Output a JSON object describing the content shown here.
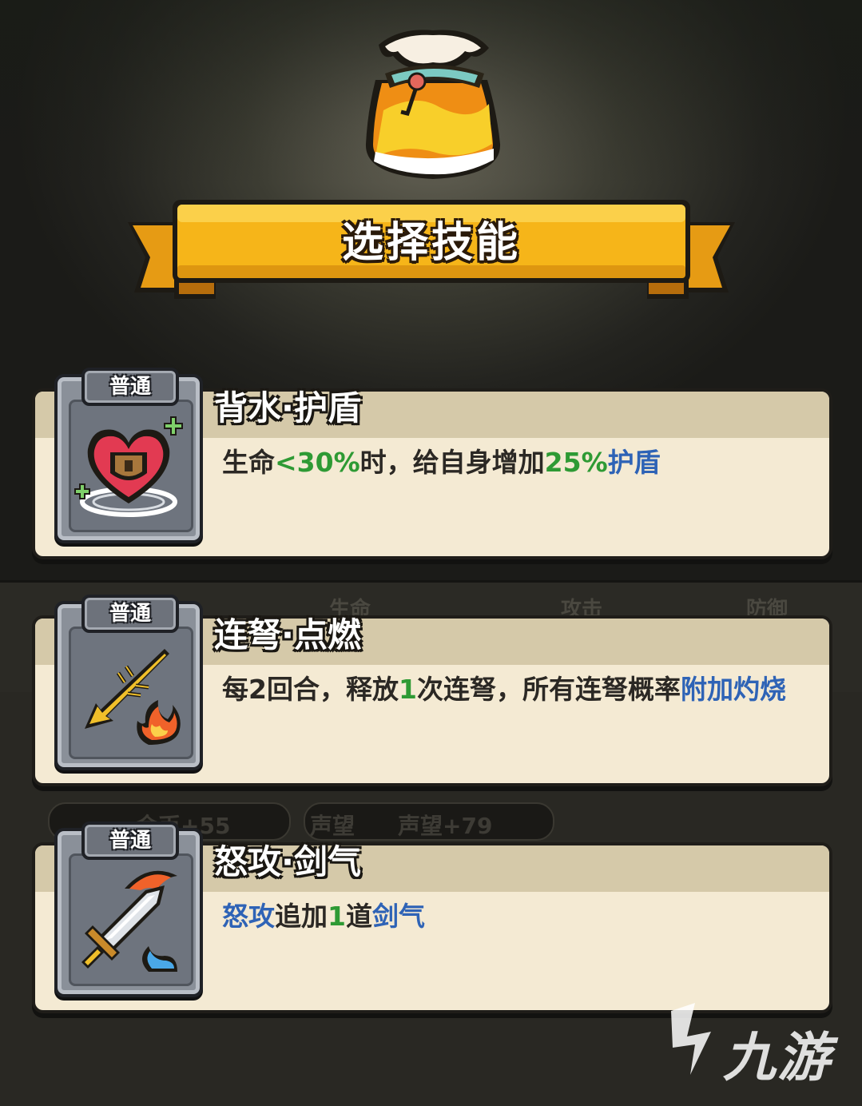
{
  "header": {
    "title": "选择技能"
  },
  "background": {
    "stats": [
      "生命",
      "攻击",
      "防御"
    ],
    "rewards": [
      "金币+55",
      "声望",
      "声望+79"
    ]
  },
  "skills": [
    {
      "tier": "普通",
      "name": "背水·护盾",
      "desc": [
        {
          "t": "生命",
          "c": "normal"
        },
        {
          "t": "<30%",
          "c": "green"
        },
        {
          "t": "时，给自身增加",
          "c": "normal"
        },
        {
          "t": "25%",
          "c": "green"
        },
        {
          "t": "护盾",
          "c": "blue"
        }
      ],
      "icon": "heart-shield-icon"
    },
    {
      "tier": "普通",
      "name": "连弩·点燃",
      "desc": [
        {
          "t": "每2回合，释放",
          "c": "normal"
        },
        {
          "t": "1",
          "c": "green"
        },
        {
          "t": "次连弩，所有连弩概率",
          "c": "normal"
        },
        {
          "t": "附加灼烧",
          "c": "blue"
        }
      ],
      "icon": "flaming-bolt-icon"
    },
    {
      "tier": "普通",
      "name": "怒攻·剑气",
      "desc": [
        {
          "t": "怒攻",
          "c": "blue"
        },
        {
          "t": "追加",
          "c": "normal"
        },
        {
          "t": "1",
          "c": "green"
        },
        {
          "t": "道",
          "c": "normal"
        },
        {
          "t": "剑气",
          "c": "blue"
        }
      ],
      "icon": "flaming-sword-icon"
    }
  ],
  "watermark": {
    "text": "九游"
  },
  "colors": {
    "banner": "#f6b519",
    "card": "#f4ead3",
    "green": "#2e9a34",
    "blue": "#2e63b6"
  }
}
